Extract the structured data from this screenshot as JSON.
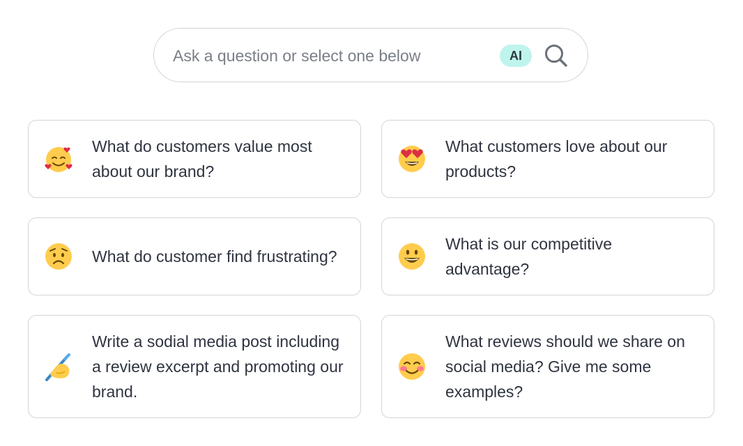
{
  "search": {
    "placeholder": "Ask a question or select one below",
    "ai_badge": "AI",
    "search_icon": "magnifier-icon"
  },
  "prompts": [
    {
      "label": "What do customers value most about our brand?",
      "icon": "smiling-face-with-hearts"
    },
    {
      "label": "What customers love about our products?",
      "icon": "heart-eyes-face"
    },
    {
      "label": "What do customer find frustrating?",
      "icon": "worried-face"
    },
    {
      "label": "What is our competitive advantage?",
      "icon": "grinning-face"
    },
    {
      "label": "Write a sodial media post including a review excerpt and promoting our brand.",
      "icon": "writing-hand"
    },
    {
      "label": "What reviews should we share on social media? Give me some examples?",
      "icon": "smiling-face-with-blush"
    }
  ],
  "colors": {
    "accent_badge": "#bff4ec",
    "border": "#d2d5da",
    "text": "#2f3440",
    "emoji_yellow": "#ffcc4d"
  }
}
